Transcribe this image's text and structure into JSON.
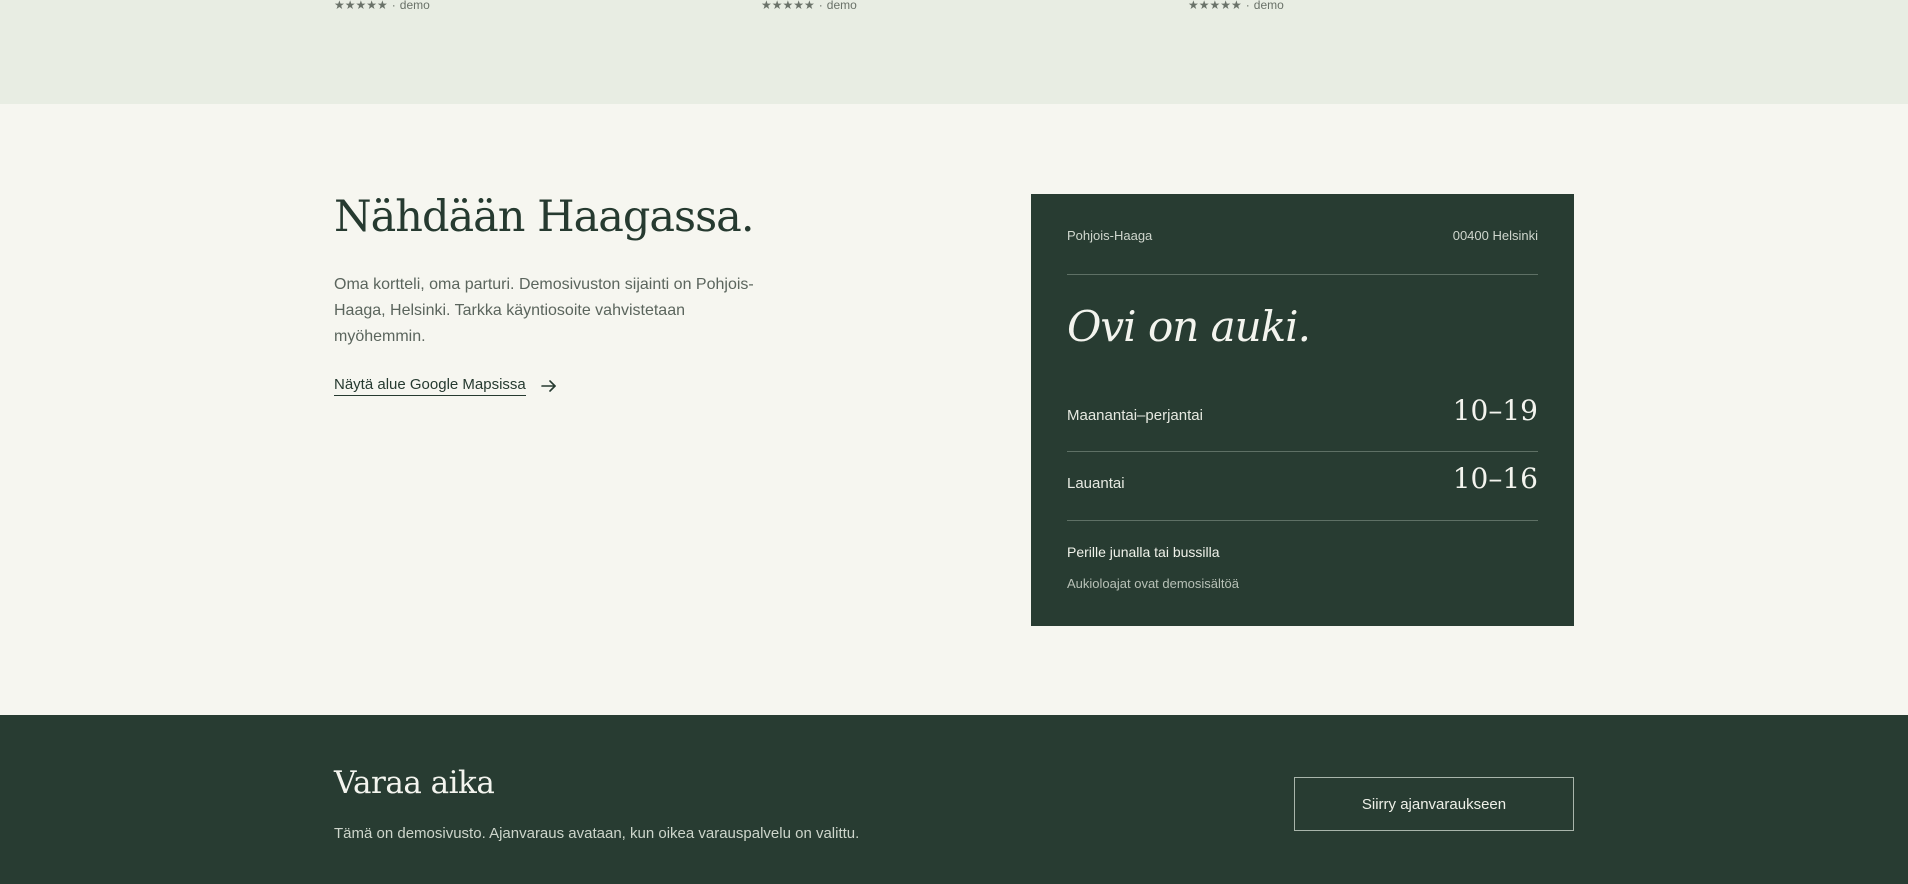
{
  "reviews": {
    "items": [
      {
        "stars": "★★★★★",
        "label": "demo"
      },
      {
        "stars": "★★★★★",
        "label": "demo"
      },
      {
        "stars": "★★★★★",
        "label": "demo"
      }
    ],
    "separator": "·"
  },
  "location": {
    "title": "Nähdään Haagassa.",
    "description": "Oma kortteli, oma parturi. Demosivuston sijainti on Pohjois-Haaga, Helsinki. Tarkka käyntiosoite vahvistetaan myöhemmin.",
    "maps_link_label": "Näytä alue Google Mapsissa",
    "link_icon": "arrow-right-icon"
  },
  "hours_card": {
    "area": "Pohjois-Haaga",
    "postal": "00400 Helsinki",
    "heading": "Ovi on auki.",
    "rows": [
      {
        "day": "Maanantai–perjantai",
        "time": "10–19"
      },
      {
        "day": "Lauantai",
        "time": "10–16"
      }
    ],
    "transit": "Perille junalla tai bussilla",
    "note": "Aukioloajat ovat demosisältöä"
  },
  "booking": {
    "title": "Varaa aika",
    "description": "Tämä on demosivusto. Ajanvaraus avataan, kun oikea varauspalvelu on valittu.",
    "button_label": "Siirry ajanvaraukseen"
  },
  "colors": {
    "page_bg": "#f6f6f0",
    "strip_bg": "#e8ede3",
    "dark_green": "#283c32",
    "ink": "#263a30"
  }
}
